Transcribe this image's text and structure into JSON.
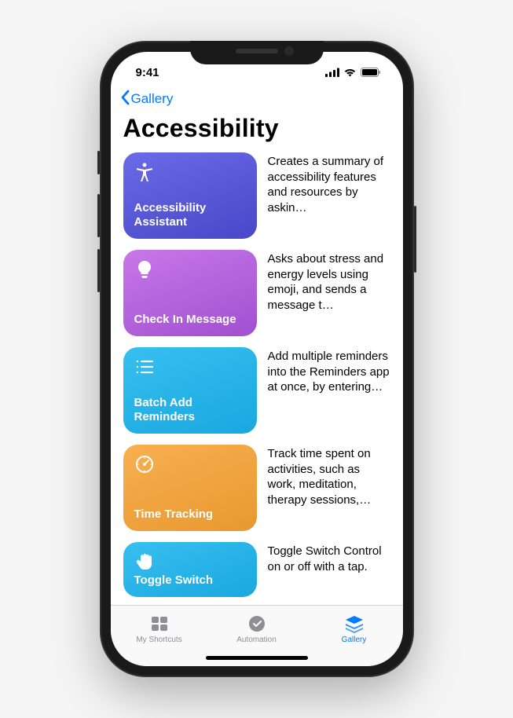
{
  "status": {
    "time": "9:41"
  },
  "nav": {
    "back_label": "Gallery"
  },
  "page": {
    "title": "Accessibility"
  },
  "shortcuts": [
    {
      "title": "Accessibility Assistant",
      "desc": "Creates a summary of accessibility features and resources by askin…",
      "icon": "accessibility-icon"
    },
    {
      "title": "Check In Message",
      "desc": "Asks about stress and energy levels using emoji, and sends a message t…",
      "icon": "lightbulb-icon"
    },
    {
      "title": "Batch Add Reminders",
      "desc": "Add multiple reminders into the Reminders app at once, by entering…",
      "icon": "list-icon"
    },
    {
      "title": "Time Tracking",
      "desc": "Track time spent on activities, such as work, meditation, therapy sessions,…",
      "icon": "gauge-icon"
    },
    {
      "title": "Toggle Switch",
      "desc": "Toggle Switch Control on or off with a tap.",
      "icon": "hand-icon"
    }
  ],
  "tabs": [
    {
      "label": "My Shortcuts",
      "icon": "grid-icon",
      "active": false
    },
    {
      "label": "Automation",
      "icon": "clock-check-icon",
      "active": false
    },
    {
      "label": "Gallery",
      "icon": "stack-icon",
      "active": true
    }
  ]
}
